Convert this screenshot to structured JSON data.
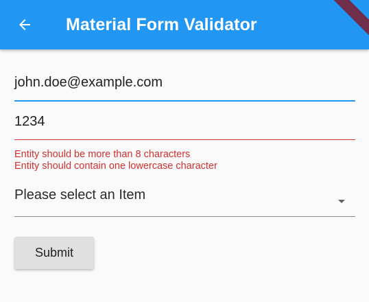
{
  "appbar": {
    "title": "Material Form Validator",
    "back_icon": "arrow-back-icon",
    "color": "#2196f3"
  },
  "form": {
    "email_value": "john.doe@example.com",
    "code_value": "1234",
    "errors": [
      "Entity should be more than 8 characters",
      "Entity should contain one lowercase character"
    ],
    "select": {
      "selected_label": "Please select an Item",
      "caret_icon": "arrow-drop-down-icon"
    },
    "submit_label": "Submit",
    "error_color": "#d32f2f"
  }
}
